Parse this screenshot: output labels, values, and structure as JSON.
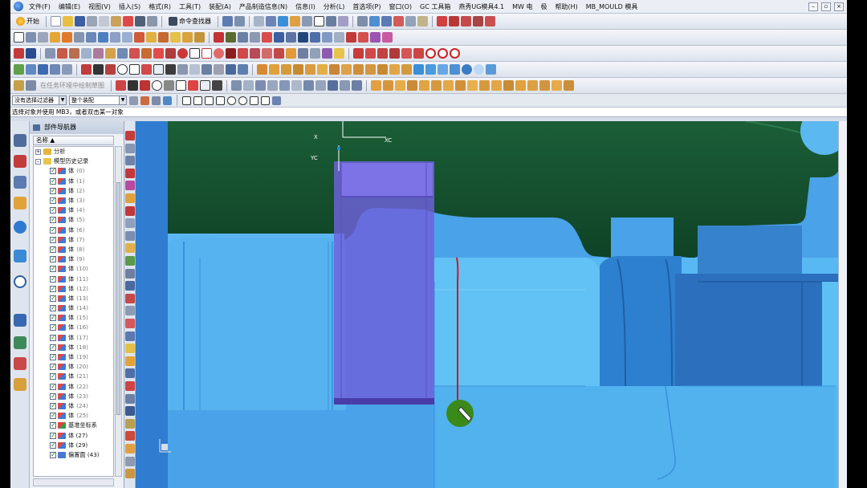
{
  "menu": {
    "items": [
      "文件(F)",
      "编辑(E)",
      "视图(V)",
      "插入(S)",
      "格式(R)",
      "工具(T)",
      "装配(A)",
      "产品制造信息(N)",
      "信息(I)",
      "分析(L)",
      "首选项(P)",
      "窗口(O)",
      "GC 工具箱",
      "燕秀UG模具4.1",
      "MW 电",
      "极",
      "帮助(H)",
      "MB_MOULD 模具"
    ]
  },
  "toolbar": {
    "start_label": "开始",
    "command_finder_label": "命令查找器"
  },
  "selection": {
    "filter_value": "没有选择过滤器",
    "assembly_value": "整个装配",
    "prompt": "选择对象并使用 MB3，或者双击某一对象"
  },
  "navigator": {
    "title": "部件导航器",
    "column_header": "名称",
    "root_analysis": "分析",
    "root_history": "模型历史记录",
    "feature_label": "体",
    "items": [
      "(0)",
      "(1)",
      "(2)",
      "(3)",
      "(4)",
      "(5)",
      "(6)",
      "(7)",
      "(8)",
      "(9)",
      "(10)",
      "(11)",
      "(12)",
      "(13)",
      "(14)",
      "(15)",
      "(16)",
      "(17)",
      "(18)",
      "(19)",
      "(20)",
      "(21)",
      "(22)",
      "(23)",
      "(24)",
      "(25)"
    ],
    "datum_csys": "基准坐标系",
    "body_27": "体 (27)",
    "body_29": "体 (29)",
    "offset_face": "偏置面 (43)"
  },
  "viewport": {
    "axis_x": "X",
    "axis_y": "YC",
    "axis_x2": "XC",
    "colors": {
      "core_blue": "#4aa3e8",
      "core_light": "#5cc0f4",
      "cavity_green": "#124c2c",
      "selected_purple": "#6f62dc",
      "cursor_green": "#3a8a1a",
      "edge_red": "#d01818"
    }
  }
}
